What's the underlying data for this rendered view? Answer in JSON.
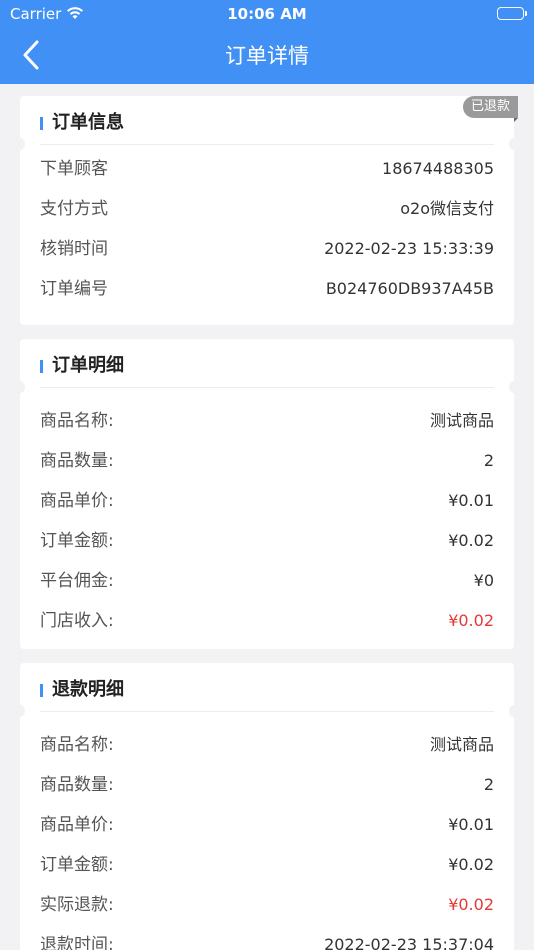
{
  "status_bar": {
    "carrier": "Carrier",
    "time": "10:06 AM"
  },
  "nav": {
    "title": "订单详情"
  },
  "order_info": {
    "title": "订单信息",
    "badge": "已退款",
    "rows": [
      {
        "label": "下单顾客",
        "value": "18674488305"
      },
      {
        "label": "支付方式",
        "value": "o2o微信支付"
      },
      {
        "label": "核销时间",
        "value": "2022-02-23 15:33:39"
      },
      {
        "label": "订单编号",
        "value": "B024760DB937A45B"
      }
    ]
  },
  "order_detail": {
    "title": "订单明细",
    "rows": [
      {
        "label": "商品名称:",
        "value": "测试商品"
      },
      {
        "label": "商品数量:",
        "value": "2"
      },
      {
        "label": "商品单价:",
        "value": "¥0.01"
      },
      {
        "label": "订单金额:",
        "value": "¥0.02"
      },
      {
        "label": "平台佣金:",
        "value": "¥0"
      },
      {
        "label": "门店收入:",
        "value": "¥0.02"
      }
    ]
  },
  "refund_detail": {
    "title": "退款明细",
    "rows": [
      {
        "label": "商品名称:",
        "value": "测试商品"
      },
      {
        "label": "商品数量:",
        "value": "2"
      },
      {
        "label": "商品单价:",
        "value": "¥0.01"
      },
      {
        "label": "订单金额:",
        "value": "¥0.02"
      },
      {
        "label": "实际退款:",
        "value": "¥0.02"
      },
      {
        "label": "退款时间:",
        "value": "2022-02-23 15:37:04"
      }
    ]
  },
  "colors": {
    "primary": "#4190f5",
    "highlight": "#e53935",
    "badge": "#9a9a9a"
  }
}
